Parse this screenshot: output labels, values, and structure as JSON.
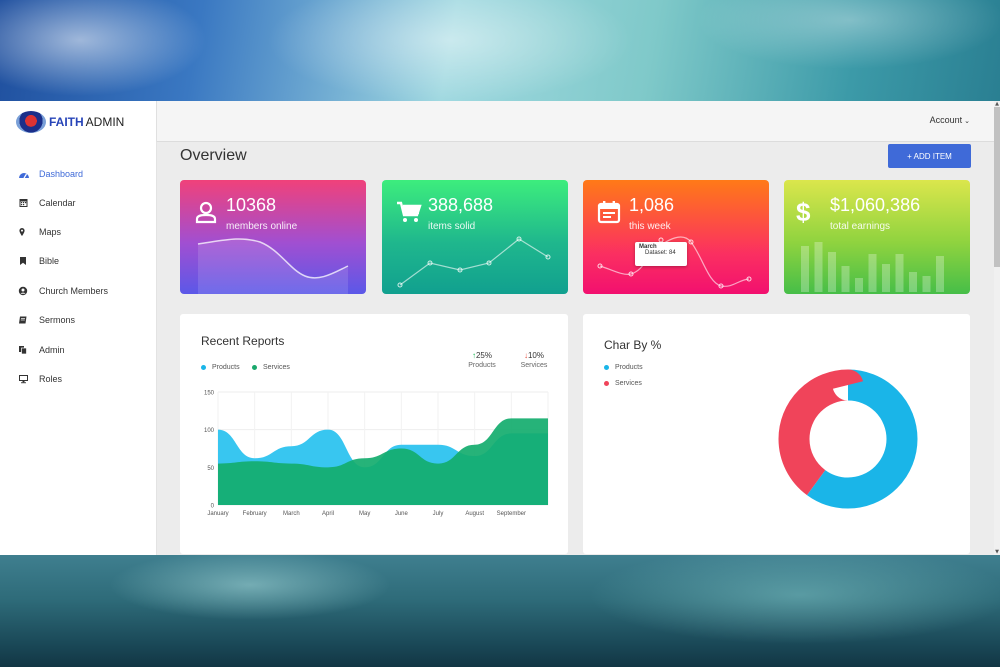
{
  "brand": {
    "faith": "FAITH",
    "admin": "ADMIN"
  },
  "header": {
    "account_label": "Account"
  },
  "sidebar": {
    "items": [
      {
        "label": "Dashboard",
        "icon": "dashboard-icon"
      },
      {
        "label": "Calendar",
        "icon": "calendar-icon"
      },
      {
        "label": "Maps",
        "icon": "map-marker-icon"
      },
      {
        "label": "Bible",
        "icon": "bookmark-icon"
      },
      {
        "label": "Church Members",
        "icon": "user-circle-icon"
      },
      {
        "label": "Sermons",
        "icon": "book-icon"
      },
      {
        "label": "Admin",
        "icon": "copy-icon"
      },
      {
        "label": "Roles",
        "icon": "desktop-icon"
      }
    ]
  },
  "main": {
    "title": "Overview",
    "add_button": "+ ADD ITEM"
  },
  "stats": [
    {
      "value": "10368",
      "label": "members online",
      "icon": "user-icon"
    },
    {
      "value": "388,688",
      "label": "items solid",
      "icon": "cart-icon"
    },
    {
      "value": "1,086",
      "label": "this week",
      "icon": "calendar-icon"
    },
    {
      "value": "$1,060,386",
      "label": "total earnings",
      "icon": "dollar-icon"
    }
  ],
  "tooltip": {
    "title": "March",
    "text": "Dataset: 84"
  },
  "recent_reports": {
    "title": "Recent Reports",
    "legend": [
      {
        "label": "Products",
        "color": "#1ab5e8"
      },
      {
        "label": "Services",
        "color": "#1aa86c"
      }
    ],
    "kpis": [
      {
        "value": "25%",
        "label": "Products",
        "direction": "up"
      },
      {
        "value": "10%",
        "label": "Services",
        "direction": "down"
      }
    ]
  },
  "char_by": {
    "title": "Char By %",
    "legend": [
      {
        "label": "Products",
        "color": "#1ab5e8"
      },
      {
        "label": "Services",
        "color": "#f0445a"
      }
    ]
  },
  "chart_data": [
    {
      "type": "area",
      "categories": [
        "January",
        "February",
        "March",
        "April",
        "May",
        "June",
        "July",
        "August",
        "September"
      ],
      "ylim": [
        0,
        150
      ],
      "yticks": [
        0,
        50,
        100,
        150
      ],
      "series": [
        {
          "name": "Products",
          "color": "#2dc3ef",
          "values": [
            100,
            62,
            78,
            100,
            50,
            80,
            80,
            65,
            95
          ]
        },
        {
          "name": "Services",
          "color": "#13ad6e",
          "values": [
            55,
            58,
            55,
            50,
            62,
            75,
            55,
            80,
            115
          ]
        }
      ]
    },
    {
      "type": "pie",
      "labels": [
        "Products",
        "Services"
      ],
      "values": [
        60,
        40
      ],
      "colors": [
        "#1ab5e8",
        "#f0445a"
      ]
    }
  ]
}
